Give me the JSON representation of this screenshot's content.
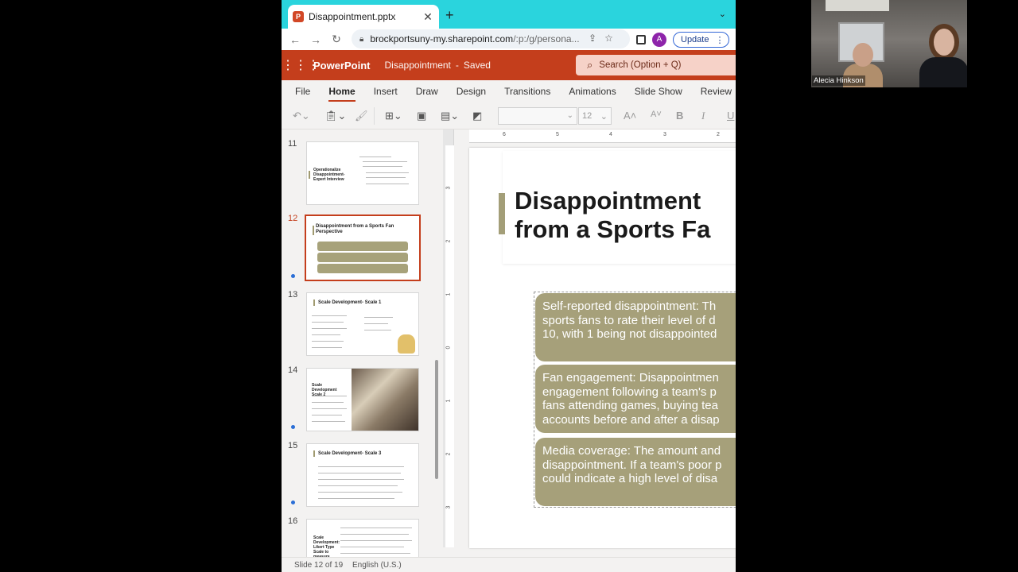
{
  "browser": {
    "tab_title": "Disappointment.pptx",
    "tab_icon": "powerpoint-favicon",
    "address_host": "brockportsuny-my.sharepoint.com",
    "address_rest": "/:p:/g/persona...",
    "update_label": "Update",
    "profile_initial": "A"
  },
  "office": {
    "app_name": "PowerPoint",
    "doc_name": "Disappointment",
    "save_status": "Saved",
    "search_placeholder": "Search (Option + Q)"
  },
  "ribbon": {
    "tabs": [
      "File",
      "Home",
      "Insert",
      "Draw",
      "Design",
      "Transitions",
      "Animations",
      "Slide Show",
      "Review"
    ],
    "active_tab": "Home",
    "font_size": "12"
  },
  "thumbnails": [
    {
      "number": "11",
      "title": "Operationalize Disappointment- Expert Interview"
    },
    {
      "number": "12",
      "title": "Disappointment from a Sports Fan Perspective"
    },
    {
      "number": "13",
      "title": "Scale Development- Scale 1"
    },
    {
      "number": "14",
      "title": "Scale Development Scale 2"
    },
    {
      "number": "15",
      "title": "Scale Development- Scale 3"
    },
    {
      "number": "16",
      "title": "Scale Development: Likert Type Scale to measure Disappointment"
    }
  ],
  "slide": {
    "title_line1": "Disappointment",
    "title_line2": "from a Sports Fa",
    "bullets": [
      "Self-reported disappointment: Th\nsports fans to rate their level of d\n10, with 1 being not disappointed",
      "Fan engagement: Disappointmen\nengagement following a team's p\nfans attending games, buying tea\naccounts before and after a disap",
      "Media coverage: The amount and\ndisappointment. If a team's poor p\ncould indicate a high level of disa"
    ]
  },
  "rulers": {
    "horizontal": [
      "6",
      "5",
      "4",
      "3",
      "2"
    ],
    "vertical": [
      "3",
      "2",
      "1",
      "0",
      "1",
      "2",
      "3"
    ]
  },
  "status": {
    "slide_info": "Slide 12 of 19",
    "language": "English (U.S.)"
  },
  "webcam": {
    "participant_name": "Alecia Hinkson"
  },
  "colors": {
    "office_red": "#c43e1c",
    "chrome_tabstrip": "#2ad4dd",
    "slide_accent": "#a39e78"
  }
}
